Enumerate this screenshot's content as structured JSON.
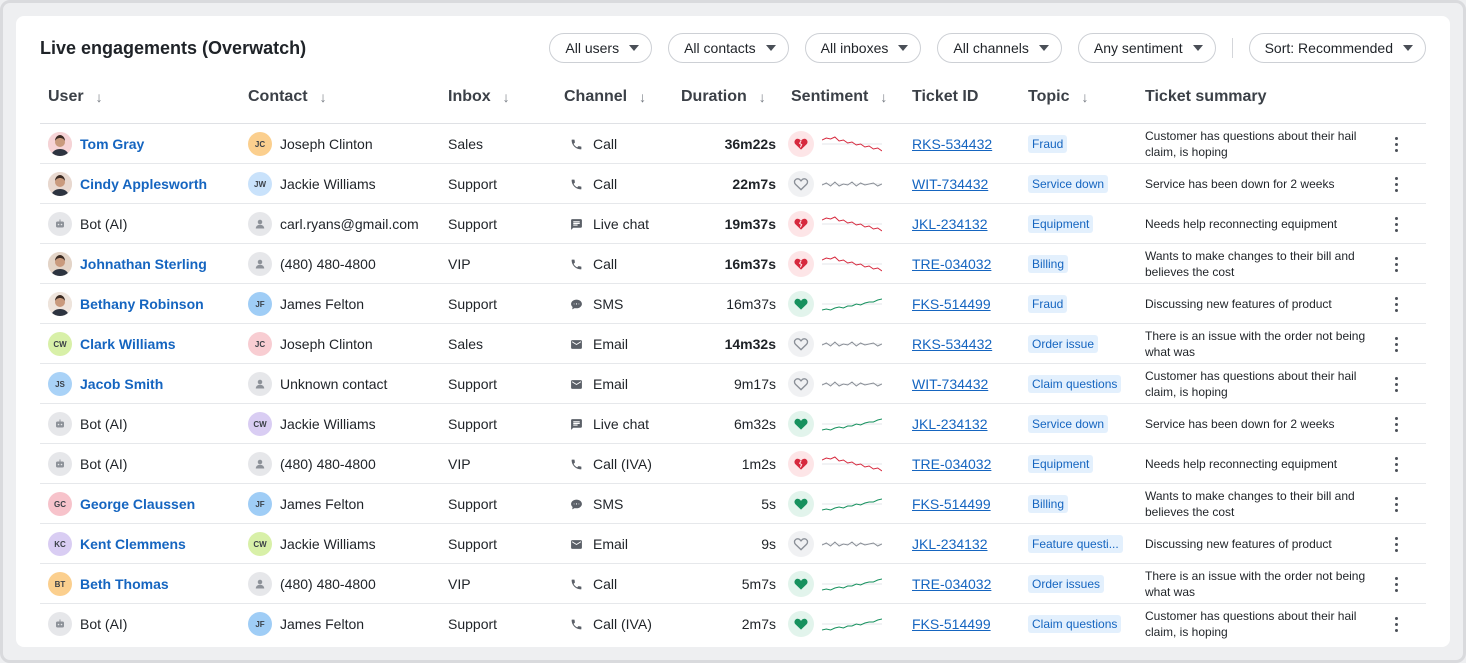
{
  "title": "Live engagements (Overwatch)",
  "filters": [
    "All users",
    "All contacts",
    "All inboxes",
    "All channels",
    "Any sentiment"
  ],
  "sort_label": "Sort: Recommended",
  "columns": {
    "user": "User",
    "contact": "Contact",
    "inbox": "Inbox",
    "channel": "Channel",
    "duration": "Duration",
    "sentiment": "Sentiment",
    "ticket_id": "Ticket ID",
    "topic": "Topic",
    "summary": "Ticket summary"
  },
  "colors": {
    "link": "#1565c0",
    "negative": "#d6293e",
    "positive": "#17915e",
    "neutral": "#8a8f97",
    "tag_bg": "#e3f0fd"
  },
  "rows": [
    {
      "user": "Tom Gray",
      "user_type": "photo",
      "avatar_color": "#f6d3d6",
      "contact": "Joseph Clinton",
      "contact_initials": "JC",
      "contact_color": "#fbcf8e",
      "inbox": "Sales",
      "channel": "Call",
      "channel_icon": "phone-icon",
      "duration": "36m22s",
      "duration_bold": true,
      "sentiment": "negative",
      "ticket": "RKS-534432",
      "topic": "Fraud",
      "summary": "Customer has questions about their hail claim, is hoping"
    },
    {
      "user": "Cindy Applesworth",
      "user_type": "photo",
      "avatar_color": "#e8d8cf",
      "contact": "Jackie Williams",
      "contact_initials": "JW",
      "contact_color": "#c9e2fb",
      "inbox": "Support",
      "channel": "Call",
      "channel_icon": "phone-icon",
      "duration": "22m7s",
      "duration_bold": true,
      "sentiment": "neutral",
      "ticket": "WIT-734432",
      "topic": "Service down",
      "summary": "Service has been down for 2 weeks"
    },
    {
      "user": "Bot (AI)",
      "user_type": "bot",
      "contact": "carl.ryans@gmail.com",
      "contact_initials": "",
      "contact_color": "#e6e7ea",
      "inbox": "Support",
      "channel": "Live chat",
      "channel_icon": "chat-icon",
      "duration": "19m37s",
      "duration_bold": true,
      "sentiment": "negative",
      "ticket": "JKL-234132",
      "topic": "Equipment",
      "summary": "Needs help reconnecting equipment"
    },
    {
      "user": "Johnathan Sterling",
      "user_type": "photo",
      "avatar_color": "#e3d4c7",
      "contact": "(480) 480-4800",
      "contact_initials": "",
      "contact_color": "#e6e7ea",
      "inbox": "VIP",
      "channel": "Call",
      "channel_icon": "phone-icon",
      "duration": "16m37s",
      "duration_bold": true,
      "sentiment": "negative",
      "ticket": "TRE-034032",
      "topic": "Billing",
      "summary": "Wants to make changes to their bill and believes the cost"
    },
    {
      "user": "Bethany Robinson",
      "user_type": "photo",
      "avatar_color": "#eee4dc",
      "contact": "James Felton",
      "contact_initials": "JF",
      "contact_color": "#9fcdf6",
      "inbox": "Support",
      "channel": "SMS",
      "channel_icon": "sms-icon",
      "duration": "16m37s",
      "duration_bold": false,
      "sentiment": "positive",
      "ticket": "FKS-514499",
      "topic": "Fraud",
      "summary": "Discussing new features of product"
    },
    {
      "user": "Clark Williams",
      "user_type": "initials",
      "user_initials": "CW",
      "avatar_color": "#d8f0a8",
      "contact": "Joseph Clinton",
      "contact_initials": "JC",
      "contact_color": "#f8cdd2",
      "inbox": "Sales",
      "channel": "Email",
      "channel_icon": "email-icon",
      "duration": "14m32s",
      "duration_bold": true,
      "sentiment": "neutral",
      "ticket": "RKS-534432",
      "topic": "Order issue",
      "summary": "There is an issue with the order not being what was"
    },
    {
      "user": "Jacob Smith",
      "user_type": "initials",
      "user_initials": "JS",
      "avatar_color": "#a9d2f7",
      "contact": "Unknown contact",
      "contact_initials": "",
      "contact_color": "#e6e7ea",
      "inbox": "Support",
      "channel": "Email",
      "channel_icon": "email-icon",
      "duration": "9m17s",
      "duration_bold": false,
      "sentiment": "neutral",
      "ticket": "WIT-734432",
      "topic": "Claim questions",
      "summary": "Customer has questions about their hail claim, is hoping"
    },
    {
      "user": "Bot (AI)",
      "user_type": "bot",
      "contact": "Jackie Williams",
      "contact_initials": "CW",
      "contact_color": "#d9cdf3",
      "inbox": "Support",
      "channel": "Live chat",
      "channel_icon": "chat-icon",
      "duration": "6m32s",
      "duration_bold": false,
      "sentiment": "positive",
      "ticket": "JKL-234132",
      "topic": "Service down",
      "summary": "Service has been down for 2 weeks"
    },
    {
      "user": "Bot (AI)",
      "user_type": "bot",
      "contact": "(480) 480-4800",
      "contact_initials": "",
      "contact_color": "#e6e7ea",
      "inbox": "VIP",
      "channel": "Call (IVA)",
      "channel_icon": "phone-icon",
      "duration": "1m2s",
      "duration_bold": false,
      "sentiment": "negative",
      "ticket": "TRE-034032",
      "topic": "Equipment",
      "summary": "Needs help reconnecting equipment"
    },
    {
      "user": "George Claussen",
      "user_type": "initials",
      "user_initials": "GC",
      "avatar_color": "#f7c3cb",
      "contact": "James Felton",
      "contact_initials": "JF",
      "contact_color": "#9fcdf6",
      "inbox": "Support",
      "channel": "SMS",
      "channel_icon": "sms-icon",
      "duration": "5s",
      "duration_bold": false,
      "sentiment": "positive",
      "ticket": "FKS-514499",
      "topic": "Billing",
      "summary": "Wants to make changes to their bill and believes the cost"
    },
    {
      "user": "Kent Clemmens",
      "user_type": "initials",
      "user_initials": "KC",
      "avatar_color": "#d9cdf3",
      "contact": "Jackie Williams",
      "contact_initials": "CW",
      "contact_color": "#d8f0a8",
      "inbox": "Support",
      "channel": "Email",
      "channel_icon": "email-icon",
      "duration": "9s",
      "duration_bold": false,
      "sentiment": "neutral",
      "ticket": "JKL-234132",
      "topic": "Feature questi...",
      "summary": "Discussing new features of product"
    },
    {
      "user": "Beth Thomas",
      "user_type": "initials",
      "user_initials": "BT",
      "avatar_color": "#fbcf8e",
      "contact": "(480) 480-4800",
      "contact_initials": "",
      "contact_color": "#e6e7ea",
      "inbox": "VIP",
      "channel": "Call",
      "channel_icon": "phone-icon",
      "duration": "5m7s",
      "duration_bold": false,
      "sentiment": "positive",
      "ticket": "TRE-034032",
      "topic": "Order issues",
      "summary": "There is an issue with the order not being what was"
    },
    {
      "user": "Bot (AI)",
      "user_type": "bot",
      "contact": "James Felton",
      "contact_initials": "JF",
      "contact_color": "#9fcdf6",
      "inbox": "Support",
      "channel": "Call (IVA)",
      "channel_icon": "phone-icon",
      "duration": "2m7s",
      "duration_bold": false,
      "sentiment": "positive",
      "ticket": "FKS-514499",
      "topic": "Claim questions",
      "summary": "Customer has questions about their hail claim, is hoping"
    }
  ]
}
